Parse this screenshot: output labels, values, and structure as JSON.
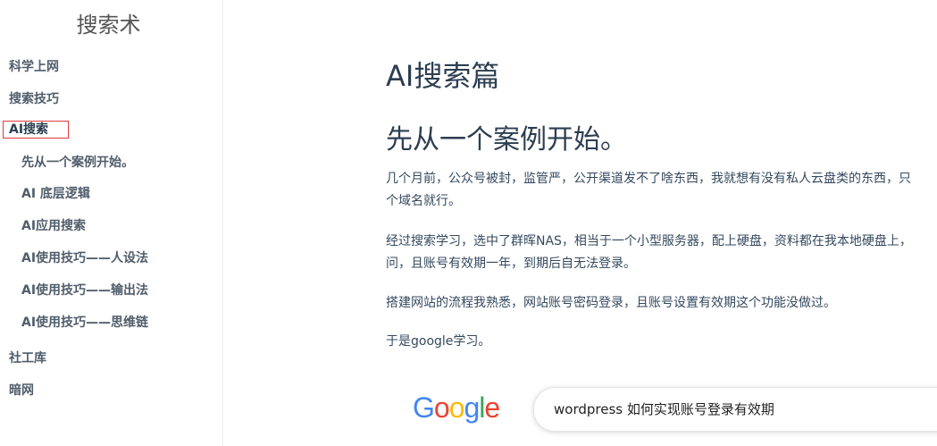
{
  "sidebar": {
    "site_title": "搜索术",
    "items": [
      {
        "label": "科学上网"
      },
      {
        "label": "搜索技巧"
      },
      {
        "label": "AI搜索"
      },
      {
        "label": "先从一个案例开始。"
      },
      {
        "label": "AI 底层逻辑"
      },
      {
        "label": "AI应用搜索"
      },
      {
        "label": "AI使用技巧——人设法"
      },
      {
        "label": "AI使用技巧——输出法"
      },
      {
        "label": "AI使用技巧——思维链"
      },
      {
        "label": "社工库"
      },
      {
        "label": "暗网"
      }
    ]
  },
  "main": {
    "title": "AI搜索篇",
    "section_heading": "先从一个案例开始。",
    "paragraphs": [
      {
        "line1": "几个月前，公众号被封，监管严，公开渠道发不了啥东西，我就想有没有私人云盘类的东西，只",
        "line2": "个域名就行。"
      },
      {
        "line1": "经过搜索学习，选中了群晖NAS，相当于一个小型服务器，配上硬盘，资料都在我本地硬盘上，",
        "line2": "问，且账号有效期一年，到期后自无法登录。"
      },
      {
        "line1": "搭建网站的流程我熟悉，网站账号密码登录，且账号设置有效期这个功能没做过。"
      },
      {
        "line1": "于是google学习。"
      }
    ],
    "google": {
      "logo_letters": [
        "G",
        "o",
        "o",
        "g",
        "l",
        "e"
      ],
      "logo_colors": [
        "#4285F4",
        "#EA4335",
        "#FBBC05",
        "#4285F4",
        "#34A853",
        "#EA4335"
      ],
      "search_query": "wordpress 如何实现账号登录有效期"
    }
  }
}
